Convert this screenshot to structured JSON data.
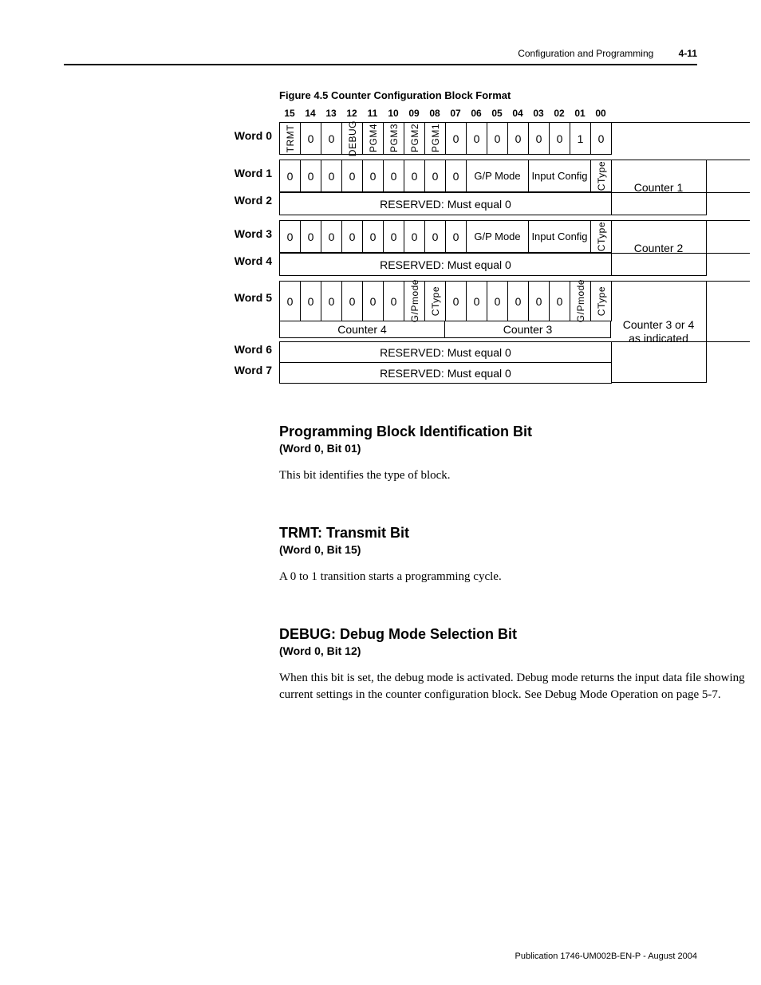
{
  "header": {
    "section": "Configuration and Programming",
    "pagenum": "4-11"
  },
  "figure": {
    "caption": "Figure 4.5 Counter Configuration Block Format"
  },
  "bits": [
    "15",
    "14",
    "13",
    "12",
    "11",
    "10",
    "09",
    "08",
    "07",
    "06",
    "05",
    "04",
    "03",
    "02",
    "01",
    "00"
  ],
  "word_labels": [
    "Word 0",
    "Word 1",
    "Word 2",
    "Word 3",
    "Word 4",
    "Word 5",
    "Word 6",
    "Word 7"
  ],
  "w0": [
    "TRMT",
    "0",
    "0",
    "DEBUG",
    "PGM4",
    "PGM3",
    "PGM2",
    "PGM1",
    "0",
    "0",
    "0",
    "0",
    "0",
    "0",
    "1",
    "0"
  ],
  "w1": {
    "leading": [
      "0",
      "0",
      "0",
      "0",
      "0",
      "0",
      "0",
      "0",
      "0"
    ],
    "gp": "G/P Mode",
    "input": "Input Config",
    "ctype": "CType"
  },
  "w3": {
    "leading": [
      "0",
      "0",
      "0",
      "0",
      "0",
      "0",
      "0",
      "0",
      "0"
    ],
    "gp": "G/P Mode",
    "input": "Input Config",
    "ctype": "CType"
  },
  "w5": {
    "c4": [
      "0",
      "0",
      "0",
      "0",
      "0",
      "0",
      "G/Pmode",
      "CType"
    ],
    "c3": [
      "0",
      "0",
      "0",
      "0",
      "0",
      "0",
      "G/Pmode",
      "CType"
    ]
  },
  "reserved": "RESERVED: Must equal 0",
  "counter_labels": {
    "c1": "Counter 1",
    "c2": "Counter 2",
    "c34": "Counter 3 or 4\nas indicated",
    "sub4": "Counter 4",
    "sub3": "Counter 3"
  },
  "sections": {
    "s1": {
      "title": "Programming Block Identification Bit",
      "sub": "(Word 0, Bit 01)",
      "body": "This bit identifies the type of block."
    },
    "s2": {
      "title": "TRMT: Transmit Bit",
      "sub": "(Word 0, Bit 15)",
      "body": "A 0 to 1 transition starts a programming cycle."
    },
    "s3": {
      "title": "DEBUG: Debug Mode Selection Bit",
      "sub": "(Word 0, Bit 12)",
      "body": "When this bit is set, the debug mode is activated. Debug mode returns the input data file showing current settings in the counter configuration block. See Debug Mode Operation on page 5-7."
    }
  },
  "footer": "Publication 1746-UM002B-EN-P - August 2004",
  "chart_data": {
    "type": "table",
    "title": "Figure 4.5 Counter Configuration Block Format",
    "columns_bits": [
      "15",
      "14",
      "13",
      "12",
      "11",
      "10",
      "09",
      "08",
      "07",
      "06",
      "05",
      "04",
      "03",
      "02",
      "01",
      "00"
    ],
    "rows": [
      {
        "word": "Word 0",
        "cells": [
          "TRMT",
          "0",
          "0",
          "DEBUG",
          "PGM4",
          "PGM3",
          "PGM2",
          "PGM1",
          "0",
          "0",
          "0",
          "0",
          "0",
          "0",
          "1",
          "0"
        ],
        "group": null
      },
      {
        "word": "Word 1",
        "cells": [
          "0",
          "0",
          "0",
          "0",
          "0",
          "0",
          "0",
          "0",
          "0",
          "G/P Mode",
          "G/P Mode",
          "G/P Mode",
          "Input Config",
          "Input Config",
          "Input Config",
          "CType"
        ],
        "group": "Counter 1"
      },
      {
        "word": "Word 2",
        "cells": [
          "RESERVED: Must equal 0"
        ],
        "group": "Counter 1"
      },
      {
        "word": "Word 3",
        "cells": [
          "0",
          "0",
          "0",
          "0",
          "0",
          "0",
          "0",
          "0",
          "0",
          "G/P Mode",
          "G/P Mode",
          "G/P Mode",
          "Input Config",
          "Input Config",
          "Input Config",
          "CType"
        ],
        "group": "Counter 2"
      },
      {
        "word": "Word 4",
        "cells": [
          "RESERVED: Must equal 0"
        ],
        "group": "Counter 2"
      },
      {
        "word": "Word 5",
        "cells": [
          "0",
          "0",
          "0",
          "0",
          "0",
          "0",
          "G/Pmode",
          "CType",
          "0",
          "0",
          "0",
          "0",
          "0",
          "0",
          "G/Pmode",
          "CType"
        ],
        "group": "Counter 3 or 4 as indicated",
        "sublabels": {
          "bits_15_08": "Counter 4",
          "bits_07_00": "Counter 3"
        }
      },
      {
        "word": "Word 6",
        "cells": [
          "RESERVED: Must equal 0"
        ],
        "group": null
      },
      {
        "word": "Word 7",
        "cells": [
          "RESERVED: Must equal 0"
        ],
        "group": null
      }
    ]
  }
}
